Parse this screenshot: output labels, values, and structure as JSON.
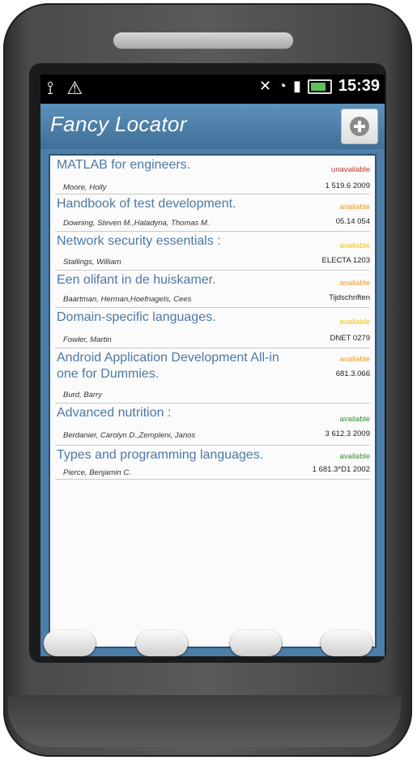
{
  "status_bar": {
    "left_icons": [
      "usb-icon",
      "warning-icon"
    ],
    "right_icons": [
      "signal-x-icon",
      "wifi-icon",
      "cell-signal-icon",
      "battery-icon"
    ],
    "time": "15:39"
  },
  "app": {
    "title": "Fancy Locator",
    "add_button_icon": "plus-circle-icon"
  },
  "items": [
    {
      "title": "MATLAB for engineers.",
      "author": "Moore, Holly",
      "status": "unavailable",
      "status_color": "#c0392b",
      "call_number": "1 519.6 2009"
    },
    {
      "title": "Handbook of test development.",
      "author": "Downing, Steven M.,Haladyna, Thomas M.",
      "status": "available",
      "status_color": "#e89a2c",
      "call_number": "05.14 054"
    },
    {
      "title": "Network security essentials :",
      "author": "Stallings, William",
      "status": "available",
      "status_color": "#e6c229",
      "call_number": "ELECTA 1203"
    },
    {
      "title": "Een olifant in de huiskamer.",
      "author": "Baartman, Herman,Hoefnagels, Cees",
      "status": "available",
      "status_color": "#e89a2c",
      "call_number": "Tijdschriften"
    },
    {
      "title": "Domain-specific languages.",
      "author": "Fowler, Martin",
      "status": "available",
      "status_color": "#e6c229",
      "call_number": "DNET 0279"
    },
    {
      "title": "Android Application Development All-in one for Dummies.",
      "title_line1": "Android Application Development All-in",
      "title_line2": "one for Dummies.",
      "author": "Burd, Barry",
      "status": "available",
      "status_color": "#e89a2c",
      "call_number": "681.3.066"
    },
    {
      "title": "Advanced nutrition :",
      "author": "Berdanier, Carolyn D.,Zempleni, Janos",
      "status": "available",
      "status_color": "#3c8a3c",
      "call_number": "3 612.3 2009"
    },
    {
      "title": "Types and programming languages.",
      "author": "Pierce, Benjamin C.",
      "status": "available",
      "status_color": "#3c8a3c",
      "call_number": "1 681.3*D1 2002"
    }
  ],
  "hardware_keys": [
    "home-key",
    "menu-key",
    "back-key",
    "search-key"
  ]
}
